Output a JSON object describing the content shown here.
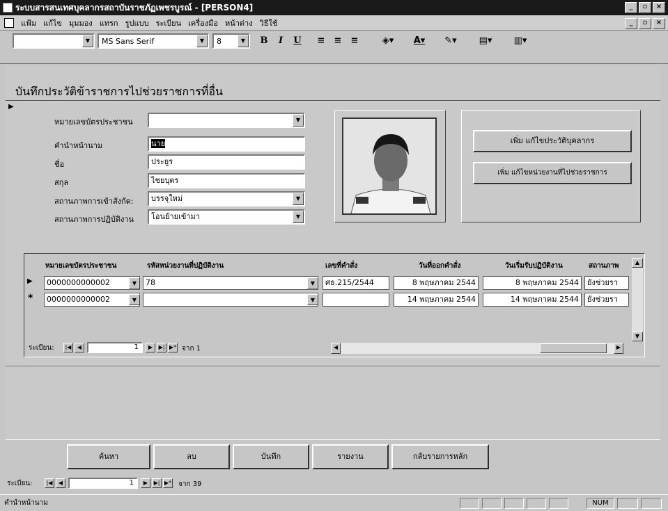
{
  "window": {
    "title": "ระบบสารสนเทศบุคลากรสถาบันราชภัฏเพชรบูรณ์ - [PERSON4]"
  },
  "menu": [
    "แฟ้ม",
    "แก้ไข",
    "มุมมอง",
    "แทรก",
    "รูปแบบ",
    "ระเบียน",
    "เครื่องมือ",
    "หน้าต่าง",
    "วิธีใช้"
  ],
  "toolbar": {
    "font": "MS Sans Serif",
    "size": "8",
    "bold": "B",
    "italic": "I",
    "underline": "U"
  },
  "form": {
    "title": "บันทึกประวัติข้าราชการไปช่วยราชการที่อื่น",
    "labels": {
      "id_card": "หมายเลขบัตรประชาชน",
      "prefix": "คำนำหน้านาม",
      "first_name": "ชื่อ",
      "last_name": "สกุล",
      "affiliation": "สถานภาพการเข้าสังกัด:",
      "work_status": "สถานภาพการปฏิบัติงาน"
    },
    "values": {
      "id_card": "",
      "prefix": "นาย",
      "first_name": "ประยูร",
      "last_name": "ไชยบุตร",
      "affiliation": "บรรจุใหม่",
      "work_status": "โอนย้ายเข้ามา"
    },
    "buttons": {
      "edit_personnel": "เพิ่ม แก้ไขประวัติบุคลากร",
      "edit_agency": "เพิ่ม แก้ไขหน่วยงานที่ไปช่วยราชการ"
    }
  },
  "subform": {
    "headers": [
      "หมายเลขบัตรประชาชน",
      "รหัสหน่วยงานที่ปฏิบัติงาน",
      "เลขที่คำสั่ง",
      "วันที่ออกคำสั่ง",
      "วันเริ่มรับปฏิบัติงาน",
      "สถานภาพ"
    ],
    "rows": [
      {
        "marker": "▶",
        "id": "0000000000002",
        "agency": "78",
        "order": "ศธ.215/2544",
        "order_date": "8 พฤษภาคม 2544",
        "start_date": "8 พฤษภาคม 2544",
        "status": "ยังช่วยรา"
      },
      {
        "marker": "*",
        "id": "0000000000002",
        "agency": "",
        "order": "",
        "order_date": "14 พฤษภาคม 2544",
        "start_date": "14 พฤษภาคม 2544",
        "status": "ยังช่วยรา"
      }
    ],
    "nav": {
      "label": "ระเบียน:",
      "current": "1",
      "total": "จาก 1"
    }
  },
  "bottom_buttons": [
    "ค้นหา",
    "ลบ",
    "บันทึก",
    "รายงาน",
    "กลับรายการหลัก"
  ],
  "main_nav": {
    "label": "ระเบียน:",
    "current": "1",
    "total": "จาก 39"
  },
  "status": {
    "text": "คำนำหน้านาม",
    "num": "NUM"
  }
}
